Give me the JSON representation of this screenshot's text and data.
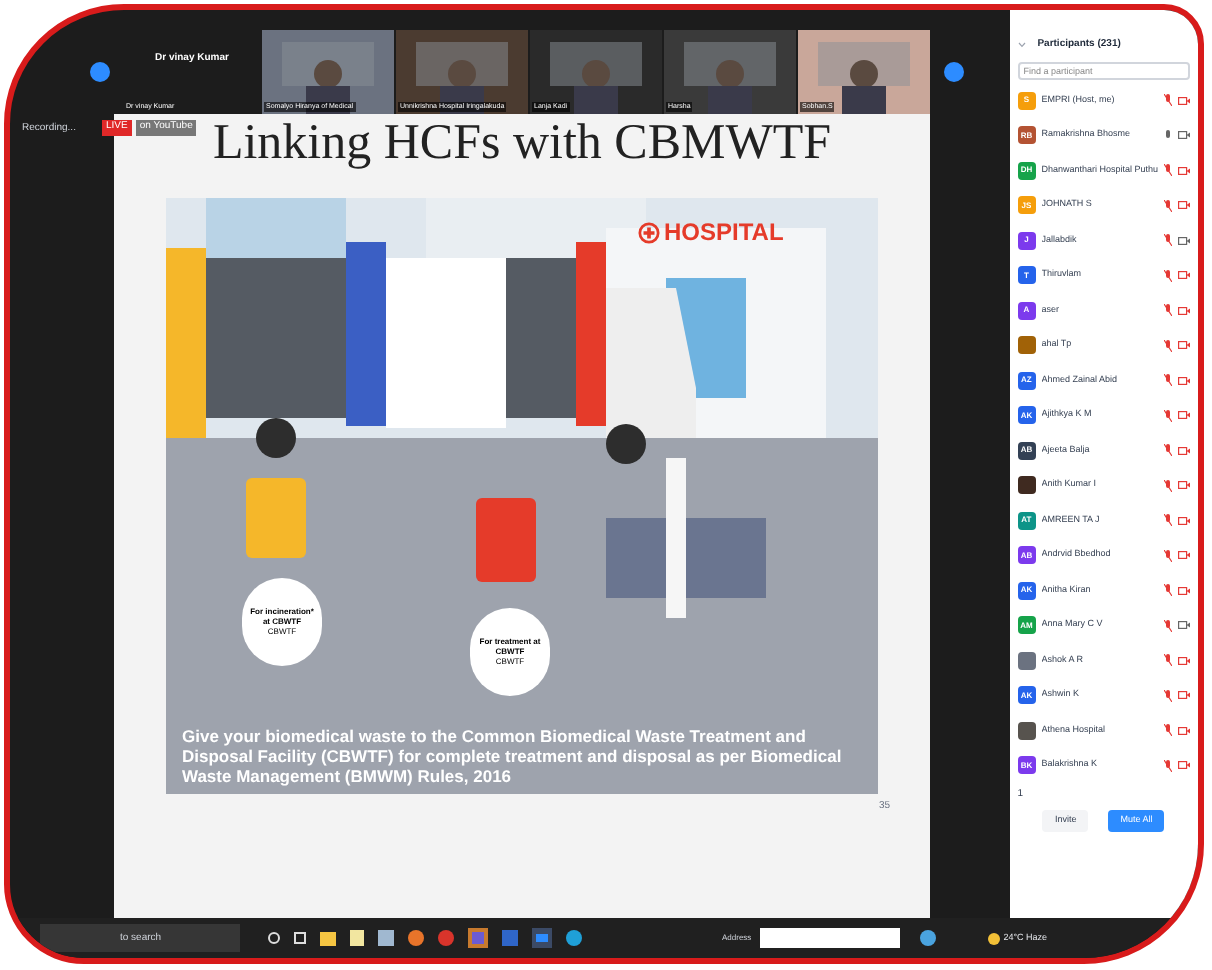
{
  "video_strip": {
    "tiles": [
      {
        "name": "Dr vinay Kumar",
        "label": "Dr vinay Kumar",
        "kind": "name"
      },
      {
        "name": "Somalyo Hiranya of Medical",
        "kind": "video"
      },
      {
        "name": "Unnikrishna Hospital Iringalakuda",
        "kind": "video"
      },
      {
        "name": "Lanja Kadi",
        "kind": "video"
      },
      {
        "name": "Harsha",
        "kind": "video"
      },
      {
        "name": "Sobhan.S",
        "kind": "video"
      }
    ]
  },
  "recording": {
    "label": "Recording...",
    "live": "LIVE",
    "stream": "on YouTube"
  },
  "slide": {
    "title": "Linking HCFs with CBMWTF",
    "hospital_sign": "HOSPITAL",
    "bubbles": [
      {
        "title": "For incineration* at CBWTF",
        "note": "CBWTF"
      },
      {
        "title": "For treatment at CBWTF",
        "note": "CBWTF"
      }
    ],
    "caption": "Give your biomedical waste to the Common Biomedical Waste Treatment and Disposal Facility (CBWTF) for complete treatment and disposal as per Biomedical Waste Management (BMWM) Rules, 2016",
    "page_number": "35"
  },
  "participants": {
    "title": "Participants (231)",
    "search": {
      "placeholder": "Find a participant"
    },
    "items": [
      {
        "initials": "S",
        "name": "EMPRI (Host, me)",
        "color": "#f59e0b",
        "muted": true,
        "video_off": true
      },
      {
        "initials": "RB",
        "name": "Ramakrishna Bhosme",
        "color": "#b45333",
        "muted": false,
        "video_off": false
      },
      {
        "initials": "DH",
        "name": "Dhanwanthari Hospital Puthu",
        "color": "#16a34a",
        "muted": true,
        "video_off": true
      },
      {
        "initials": "JS",
        "name": "JOHNATH S",
        "color": "#f59e0b",
        "muted": true,
        "video_off": true
      },
      {
        "initials": "J",
        "name": "Jallabdik",
        "color": "#7c3aed",
        "muted": true,
        "video_off": false
      },
      {
        "initials": "T",
        "name": "Thiruvlam",
        "color": "#2563eb",
        "muted": true,
        "video_off": true
      },
      {
        "initials": "A",
        "name": "aser",
        "color": "#7c3aed",
        "muted": true,
        "video_off": true
      },
      {
        "name": "ahal Tp",
        "color": "#a16207",
        "muted": true,
        "video_off": true
      },
      {
        "initials": "AZ",
        "name": "Ahmed Zainal Abid",
        "color": "#2563eb",
        "muted": true,
        "video_off": true
      },
      {
        "initials": "AK",
        "name": "Ajithkya K M",
        "color": "#2563eb",
        "muted": true,
        "video_off": true
      },
      {
        "initials": "AB",
        "name": "Ajeeta Balja",
        "color": "#334155",
        "muted": true,
        "video_off": true
      },
      {
        "name": "Anith Kumar I",
        "color": "#3f2a20",
        "muted": true,
        "video_off": true
      },
      {
        "initials": "AT",
        "name": "AMREEN TA J",
        "color": "#0d9488",
        "muted": true,
        "video_off": true
      },
      {
        "initials": "AB",
        "name": "Andrvid Bbedhod",
        "color": "#7c3aed",
        "muted": true,
        "video_off": true
      },
      {
        "initials": "AK",
        "name": "Anitha Kiran",
        "color": "#2563eb",
        "muted": true,
        "video_off": true
      },
      {
        "initials": "AM",
        "name": "Anna Mary C V",
        "color": "#16a34a",
        "muted": true,
        "video_off": false
      },
      {
        "name": "Ashok A R",
        "color": "#6b7280",
        "muted": true,
        "video_off": true
      },
      {
        "initials": "AK",
        "name": "Ashwin K",
        "color": "#2563eb",
        "muted": true,
        "video_off": true
      },
      {
        "name": "Athena Hospital",
        "color": "#57534e",
        "muted": true,
        "video_off": true
      },
      {
        "initials": "BK",
        "name": "Balakrishna K",
        "color": "#7c3aed",
        "muted": true,
        "video_off": true
      }
    ],
    "hands": "1",
    "buttons": [
      "Invite",
      "Mute All"
    ]
  },
  "taskbar": {
    "search": "to search",
    "address_label": "Address",
    "weather": "24°C Haze"
  }
}
